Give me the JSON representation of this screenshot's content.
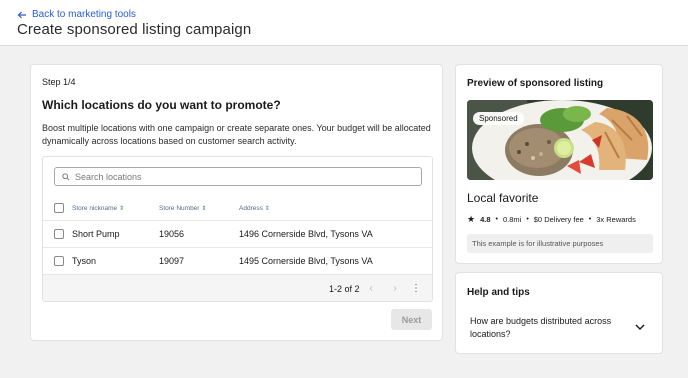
{
  "header": {
    "back_label": "Back to marketing tools",
    "title": "Create sponsored listing campaign"
  },
  "main": {
    "step": "Step 1/4",
    "question": "Which locations do you want to promote?",
    "description": "Boost multiple locations with one campaign or create separate ones. Your budget will be allocated dynamically across locations based on customer search activity.",
    "search_placeholder": "Search locations",
    "columns": [
      "Store nickname",
      "Store Number",
      "Address"
    ],
    "rows": [
      {
        "nickname": "Short Pump",
        "number": "19056",
        "address": "1496 Cornerside Blvd, Tysons VA"
      },
      {
        "nickname": "Tyson",
        "number": "19097",
        "address": "1495 Cornerside Blvd, Tysons VA"
      }
    ],
    "pagination": "1-2 of 2",
    "next_label": "Next"
  },
  "preview": {
    "title": "Preview of sponsored listing",
    "badge": "Sponsored",
    "name": "Local favorite",
    "rating": "4.8",
    "distance": "0.8mi",
    "delivery": "$0 Delivery fee",
    "rewards": "3x Rewards",
    "note": "This example is for illustrative purposes"
  },
  "help": {
    "title": "Help and tips",
    "question": "How are budgets distributed across locations?"
  },
  "colors": {
    "link": "#2a5bd7",
    "background": "#f1f1f1",
    "disabled_button": "#e7e7e7"
  }
}
